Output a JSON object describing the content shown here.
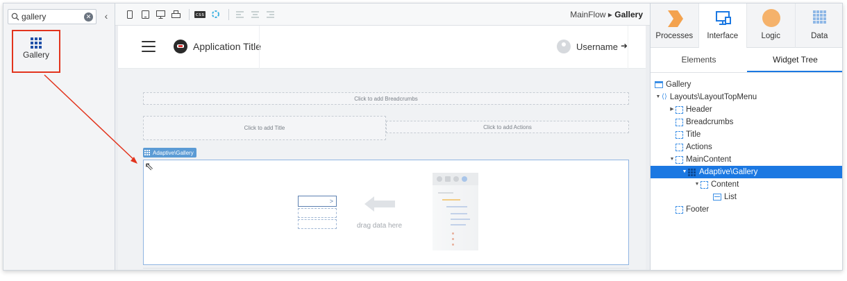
{
  "toolbox": {
    "search_value": "gallery",
    "clear_icon": "clear-icon",
    "collapse_icon": "chevron-left-icon",
    "result_label": "Gallery",
    "result_icon": "gallery-grid-icon",
    "highlight_color": "#e2341d"
  },
  "canvas_toolbar": {
    "device_icons": [
      "phone-icon",
      "tablet-icon",
      "desktop-icon",
      "print-icon"
    ],
    "css_badge": "css",
    "align_icons": [
      "align-left-icon",
      "align-center-icon",
      "align-right-icon"
    ],
    "path_parent": "MainFlow",
    "path_separator": "▸",
    "path_current": "Gallery"
  },
  "app_header": {
    "title": "Application Title",
    "username": "Username"
  },
  "placeholders": {
    "breadcrumbs": "Click to add Breadcrumbs",
    "title": "Click to add Title",
    "actions": "Click to add Actions"
  },
  "gallery_widget": {
    "tag_label": "Adaptive\\Gallery",
    "card_chevron": ">",
    "drag_hint": "drag data here"
  },
  "right_panel": {
    "tabs": [
      {
        "label": "Processes",
        "icon": "processes-icon",
        "active": false
      },
      {
        "label": "Interface",
        "icon": "interface-icon",
        "active": true
      },
      {
        "label": "Logic",
        "icon": "logic-icon",
        "active": false
      },
      {
        "label": "Data",
        "icon": "data-icon",
        "active": false
      }
    ],
    "subtabs": [
      {
        "label": "Elements",
        "active": false
      },
      {
        "label": "Widget Tree",
        "active": true
      }
    ],
    "tree": [
      {
        "label": "Gallery",
        "icon": "screen-icon",
        "depth": 0,
        "caret": "",
        "selected": false
      },
      {
        "label": "Layouts\\LayoutTopMenu",
        "icon": "layout-icon",
        "depth": 0,
        "caret": "▼",
        "selected": false
      },
      {
        "label": "Header",
        "icon": "placeholder-icon",
        "depth": 1,
        "caret": "▶",
        "selected": false
      },
      {
        "label": "Breadcrumbs",
        "icon": "placeholder-icon",
        "depth": 1,
        "caret": "",
        "selected": false
      },
      {
        "label": "Title",
        "icon": "placeholder-icon",
        "depth": 1,
        "caret": "",
        "selected": false
      },
      {
        "label": "Actions",
        "icon": "placeholder-icon",
        "depth": 1,
        "caret": "",
        "selected": false
      },
      {
        "label": "MainContent",
        "icon": "placeholder-icon",
        "depth": 1,
        "caret": "▼",
        "selected": false
      },
      {
        "label": "Adaptive\\Gallery",
        "icon": "gallery-grid-icon",
        "depth": 2,
        "caret": "▼",
        "selected": true
      },
      {
        "label": "Content",
        "icon": "placeholder-icon",
        "depth": 3,
        "caret": "▼",
        "selected": false
      },
      {
        "label": "List",
        "icon": "list-icon",
        "depth": 4,
        "caret": "",
        "selected": false
      },
      {
        "label": "Footer",
        "icon": "placeholder-icon",
        "depth": 1,
        "caret": "",
        "selected": false
      }
    ],
    "selection_color": "#1b78e2"
  }
}
